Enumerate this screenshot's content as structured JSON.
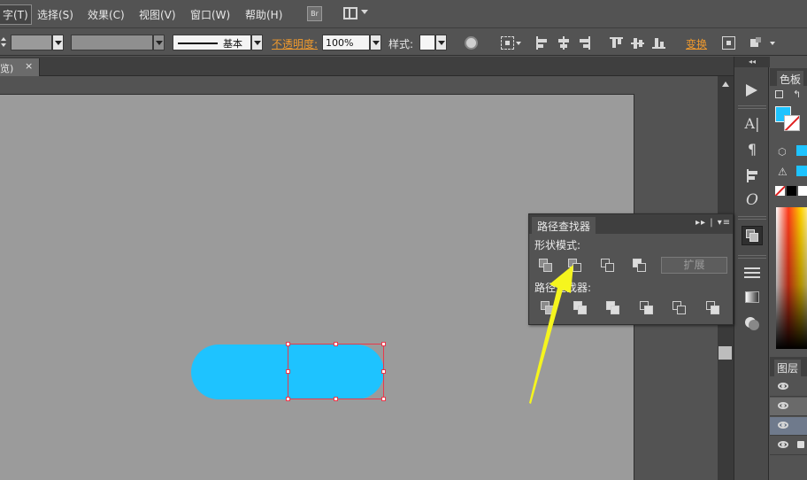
{
  "menubar": {
    "items": [
      "字(T)",
      "选择(S)",
      "效果(C)",
      "视图(V)",
      "窗口(W)",
      "帮助(H)"
    ],
    "bridge_label": "Br"
  },
  "control": {
    "stroke_style_label": "基本",
    "opacity_link": "不透明度:",
    "opacity_value": "100%",
    "style_label": "样式:",
    "transform_link": "变换"
  },
  "doc_tab": {
    "label": "览)",
    "close": "×"
  },
  "right_panel": {
    "swatches_tab": "色板",
    "layers_tab": "图层",
    "fill_color": "#1ec3ff"
  },
  "pathfinder": {
    "title": "路径查找器",
    "shape_modes_label": "形状模式:",
    "pathfinders_label": "路径查找器:",
    "expand_button": "扩展",
    "panel_controls": "▸▸ | ▾≡"
  },
  "colors": {
    "shape_fill": "#1ec3ff",
    "selection": "#e8394c",
    "annotation_arrow": "#f5f51e"
  }
}
